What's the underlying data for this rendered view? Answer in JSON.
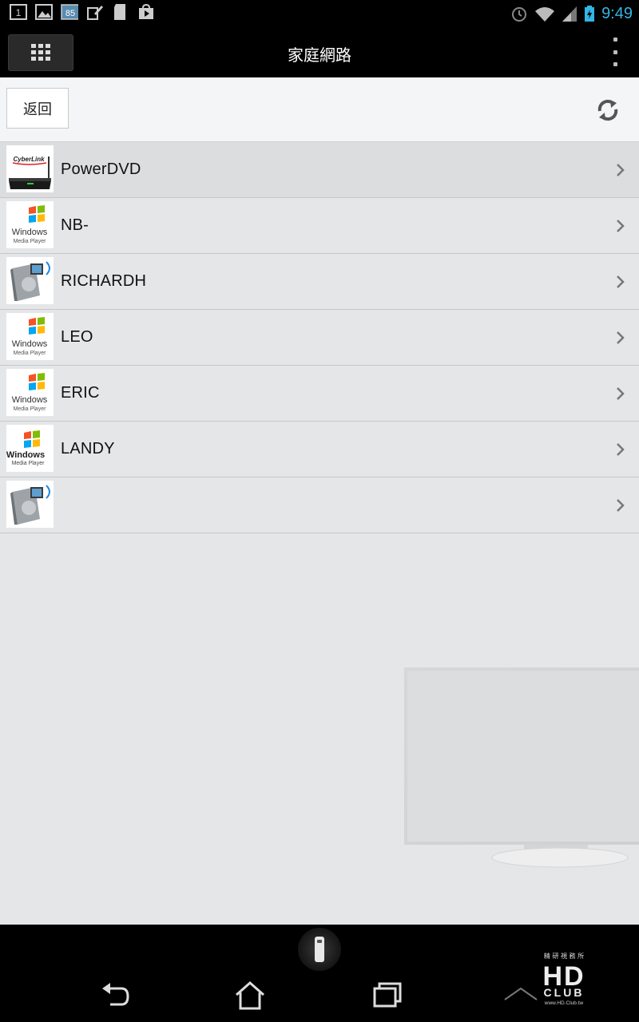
{
  "status_bar": {
    "notification_badge": "1",
    "battery_level_badge": "85",
    "time": "9:49"
  },
  "action_bar": {
    "title": "家庭網路"
  },
  "toolbar": {
    "back_label": "返回"
  },
  "servers": [
    {
      "name": "PowerDVD",
      "icon": "cyberlink-router-icon"
    },
    {
      "name": "NB-",
      "icon": "windows-media-player-icon"
    },
    {
      "name": "RICHARDH",
      "icon": "media-server-icon"
    },
    {
      "name": "LEO",
      "icon": "windows-media-player-icon"
    },
    {
      "name": "ERIC",
      "icon": "windows-media-player-icon"
    },
    {
      "name": "LANDY",
      "icon": "windows-media-player-icon"
    },
    {
      "name": "",
      "icon": "media-server-icon"
    }
  ],
  "thumb_text": {
    "cyberlink": "CyberLink",
    "windows": "Windows",
    "media_player": "Media Player"
  },
  "watermark": {
    "top_text": "精 研 視 務 所",
    "logo_text": "HD CLUB",
    "url": "www.HD.Club.tw"
  },
  "colors": {
    "accent": "#33b5e5",
    "background": "#e5e6e8",
    "bar": "#000000"
  }
}
